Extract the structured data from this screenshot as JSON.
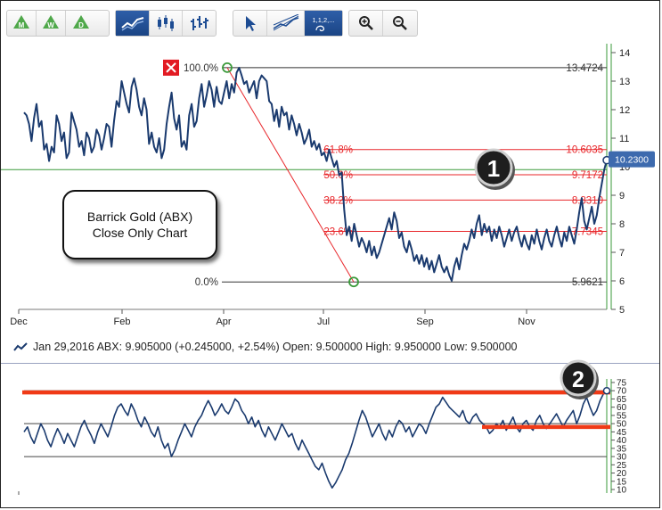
{
  "toolbar": {
    "groups": [
      [
        "monthly-button",
        "weekly-button",
        "daily-button"
      ],
      [
        "line-chart-button",
        "candlestick-button",
        "ohlc-bars-button"
      ],
      [
        "pointer-tool-button",
        "trendline-tool-button",
        "fibonacci-tool-button"
      ],
      [
        "zoom-in-button",
        "zoom-out-button"
      ]
    ],
    "labels": {
      "monthly": "M",
      "weekly": "W",
      "daily": "D",
      "fib": "1,1,2,..."
    },
    "icons": [
      "pointer-icon",
      "trendline-icon",
      "zoom-in-icon",
      "zoom-out-icon"
    ],
    "colors": {
      "period_green": "#4fa84a",
      "active_blue": "#2b5ca8"
    }
  },
  "callout": {
    "line1": "Barrick Gold (ABX)",
    "line2": "Close Only Chart"
  },
  "badges": [
    "1",
    "2"
  ],
  "info_bar": {
    "text": "Jan 29,2016 ABX: 9.905000 (+0.245000, +2.54%) Open: 9.500000 High: 9.950000 Low: 9.500000"
  },
  "colors": {
    "price_line": "#1a3a6e",
    "fib_red": "#e8262a",
    "highlight_red": "#f03a17",
    "green": "#3a9a3a",
    "current_label_bg": "#3d6aae"
  },
  "chart_data": [
    {
      "type": "line",
      "title": "",
      "xlabel": "",
      "ylabel": "",
      "x_ticks": [
        "Dec",
        "Feb",
        "Apr",
        "Jul",
        "Sep",
        "Nov"
      ],
      "y_ticks": [
        5,
        6,
        7,
        8,
        9,
        10,
        11,
        12,
        13,
        14
      ],
      "ylim": [
        5,
        14
      ],
      "grid": false,
      "series": [
        {
          "values": [
            11.9,
            11.8,
            11.5,
            10.9,
            11.7,
            12.2,
            11.4,
            11.6,
            10.6,
            10.8,
            10.2,
            10.7,
            10.5,
            11.8,
            11.5,
            10.9,
            11.2,
            10.3,
            10.5,
            11.9,
            11.6,
            11.3,
            10.7,
            10.9,
            10.4,
            11.2,
            11.0,
            10.5,
            10.7,
            11.3,
            11.1,
            10.6,
            11.0,
            11.5,
            11.4,
            10.7,
            11.6,
            12.3,
            12.1,
            13.0,
            12.6,
            12.2,
            11.9,
            12.8,
            13.1,
            12.7,
            12.1,
            11.8,
            12.4,
            12.0,
            10.8,
            11.2,
            10.7,
            10.5,
            11.0,
            10.3,
            10.6,
            11.5,
            12.1,
            12.6,
            11.7,
            11.3,
            11.8,
            10.7,
            10.9,
            10.6,
            11.8,
            12.2,
            11.4,
            11.6,
            12.4,
            12.9,
            12.1,
            12.5,
            13.0,
            12.7,
            12.1,
            12.8,
            12.3,
            12.2,
            12.6,
            13.0,
            12.4,
            12.9,
            12.6,
            13.3,
            13.47,
            13.2,
            12.9,
            13.0,
            12.6,
            12.8,
            13.0,
            12.4,
            13.0,
            13.2,
            13.1,
            13.0,
            12.3,
            12.2,
            11.6,
            12.0,
            11.4,
            12.1,
            11.8,
            11.9,
            11.3,
            11.8,
            11.5,
            11.1,
            11.5,
            11.2,
            10.8,
            11.0,
            11.3,
            10.7,
            10.9,
            10.6,
            10.8,
            10.4,
            10.5,
            10.2,
            10.6,
            10.3,
            10.0,
            10.2,
            9.7,
            9.8,
            8.5,
            7.6,
            7.9,
            7.4,
            8.0,
            7.6,
            7.2,
            7.5,
            7.3,
            7.0,
            7.4,
            6.9,
            7.2,
            6.8,
            7.0,
            7.3,
            7.6,
            7.9,
            8.2,
            7.8,
            8.4,
            8.1,
            7.5,
            7.7,
            7.2,
            7.0,
            7.4,
            7.1,
            6.7,
            6.9,
            6.6,
            6.9,
            6.5,
            6.8,
            6.4,
            6.7,
            6.3,
            6.6,
            6.9,
            6.5,
            6.3,
            6.5,
            6.2,
            6.0,
            6.5,
            6.8,
            6.4,
            6.9,
            7.3,
            7.1,
            7.4,
            7.8,
            7.5,
            8.0,
            8.3,
            7.6,
            8.0,
            7.7,
            7.9,
            7.4,
            7.8,
            7.5,
            7.9,
            7.6,
            7.2,
            7.5,
            7.8,
            7.4,
            7.7,
            7.9,
            7.5,
            7.2,
            7.6,
            7.3,
            7.1,
            7.6,
            7.3,
            7.8,
            7.4,
            7.1,
            7.5,
            7.8,
            7.4,
            7.2,
            7.6,
            7.9,
            7.5,
            7.2,
            7.7,
            7.4,
            7.9,
            7.6,
            7.3,
            7.8,
            8.4,
            8.9,
            8.1,
            7.8,
            8.2,
            8.6,
            8.0,
            8.3,
            8.9,
            9.4,
            9.9,
            10.23
          ]
        }
      ],
      "fibonacci_retracement": {
        "high": 13.4724,
        "low": 5.9621,
        "levels": [
          {
            "label": "100.0%",
            "value": 13.4724
          },
          {
            "label": "61.8%",
            "value": 10.6035
          },
          {
            "label": "50.0%",
            "value": 9.7172
          },
          {
            "label": "38.2%",
            "value": 8.831
          },
          {
            "label": "23.6%",
            "value": 7.7345
          },
          {
            "label": "0.0%",
            "value": 5.9621
          }
        ],
        "level_labels": [
          "100.0%",
          "61.8%",
          "50.0%",
          "38.2%",
          "23.6%",
          "0.0%"
        ],
        "value_labels": [
          "13.4724",
          "10.6035",
          "9.7172",
          "8.8310",
          "7.7345",
          "5.9621"
        ]
      },
      "current_value_label": "10.2300",
      "reference_line": 9.9
    },
    {
      "type": "line",
      "title": "",
      "y_ticks": [
        10,
        15,
        20,
        25,
        30,
        35,
        40,
        45,
        50,
        55,
        60,
        65,
        70,
        75
      ],
      "ylim": [
        10,
        75
      ],
      "horizontal_lines": [
        70,
        50,
        30
      ],
      "series": [
        {
          "values": [
            45,
            48,
            42,
            38,
            44,
            50,
            46,
            40,
            36,
            42,
            47,
            43,
            38,
            44,
            40,
            36,
            42,
            48,
            52,
            47,
            43,
            38,
            45,
            50,
            46,
            42,
            48,
            55,
            60,
            62,
            58,
            55,
            62,
            58,
            52,
            48,
            54,
            50,
            45,
            42,
            48,
            40,
            35,
            38,
            30,
            34,
            40,
            45,
            50,
            46,
            42,
            48,
            52,
            55,
            60,
            64,
            60,
            55,
            58,
            62,
            58,
            56,
            60,
            65,
            63,
            58,
            55,
            50,
            54,
            48,
            52,
            46,
            42,
            48,
            44,
            40,
            45,
            50,
            46,
            42,
            44,
            38,
            34,
            40,
            36,
            32,
            28,
            24,
            22,
            26,
            20,
            15,
            11,
            14,
            18,
            22,
            28,
            32,
            38,
            45,
            52,
            58,
            54,
            48,
            42,
            46,
            50,
            44,
            40,
            46,
            42,
            48,
            52,
            50,
            45,
            48,
            42,
            46,
            50,
            48,
            44,
            50,
            55,
            60,
            62,
            66,
            63,
            60,
            58,
            56,
            54,
            58,
            52,
            50,
            54,
            56,
            52,
            50,
            48,
            44,
            46,
            50,
            48,
            52,
            46,
            50,
            54,
            48,
            45,
            50,
            52,
            48,
            46,
            52,
            55,
            50,
            47,
            50,
            53,
            56,
            52,
            48,
            52,
            55,
            58,
            50,
            55,
            62,
            66,
            60,
            55,
            58,
            64,
            68,
            70
          ]
        }
      ],
      "highlight_lines": [
        69,
        48
      ]
    }
  ]
}
